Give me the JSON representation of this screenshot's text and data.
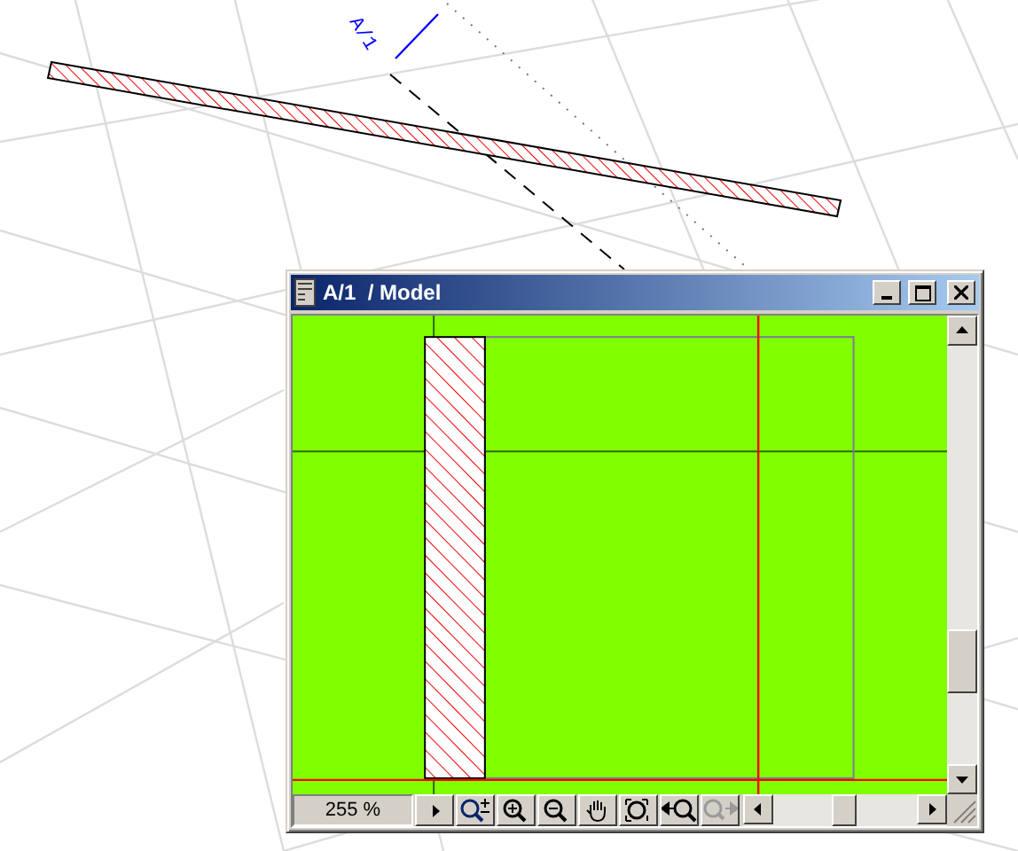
{
  "canvas": {
    "section_label": "A/1"
  },
  "window": {
    "title": "A/1  / Model",
    "zoom_field": {
      "value": "255 %"
    },
    "tools": [
      {
        "kind": "menu-arrow",
        "disabled": false
      },
      {
        "kind": "zoom-toggle",
        "disabled": false
      },
      {
        "kind": "zoom-in",
        "disabled": false
      },
      {
        "kind": "zoom-out",
        "disabled": false
      },
      {
        "kind": "pan",
        "disabled": false
      },
      {
        "kind": "fit",
        "disabled": false
      },
      {
        "kind": "zoom-back",
        "disabled": false
      },
      {
        "kind": "zoom-forward",
        "disabled": true
      }
    ]
  }
}
